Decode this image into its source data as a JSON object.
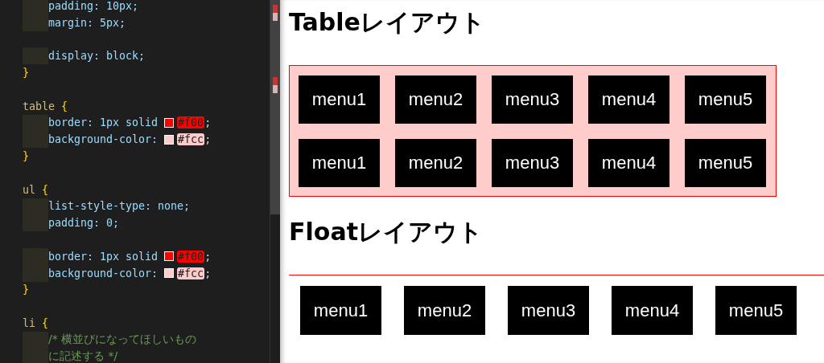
{
  "editor": {
    "lines": [
      {
        "kind": "decl",
        "text": "padding: 10px;"
      },
      {
        "kind": "decl",
        "text": "margin: 5px;"
      },
      {
        "kind": "blank"
      },
      {
        "kind": "decl",
        "text": "display: block;"
      },
      {
        "kind": "close",
        "text": "}"
      },
      {
        "kind": "blank"
      },
      {
        "kind": "open",
        "selector": "table",
        "brace": "{"
      },
      {
        "kind": "color",
        "text": "border: 1px solid",
        "color": "#ff0000",
        "code": "#f00",
        "end": ";"
      },
      {
        "kind": "color",
        "text": "background-color:",
        "color": "#ffcccc",
        "code": "#fcc",
        "end": ";"
      },
      {
        "kind": "close",
        "text": "}"
      },
      {
        "kind": "blank"
      },
      {
        "kind": "open",
        "selector": "ul",
        "brace": "{"
      },
      {
        "kind": "decl",
        "text": "list-style-type: none;"
      },
      {
        "kind": "decl",
        "text": "padding: 0;"
      },
      {
        "kind": "blank"
      },
      {
        "kind": "color",
        "text": "border: 1px solid",
        "color": "#ff0000",
        "code": "#f00",
        "end": ";"
      },
      {
        "kind": "color",
        "text": "background-color:",
        "color": "#ffcccc",
        "code": "#fcc",
        "end": ";"
      },
      {
        "kind": "close",
        "text": "}"
      },
      {
        "kind": "blank"
      },
      {
        "kind": "open",
        "selector": "li",
        "brace": "{"
      },
      {
        "kind": "comment",
        "text": "/* 横並びになってほしいもの"
      },
      {
        "kind": "comment",
        "text": "に記述する */"
      }
    ]
  },
  "preview": {
    "table_section": {
      "heading": "Tableレイアウト",
      "rows": [
        [
          "menu1",
          "menu2",
          "menu3",
          "menu4",
          "menu5"
        ],
        [
          "menu1",
          "menu2",
          "menu3",
          "menu4",
          "menu5"
        ]
      ]
    },
    "float_section": {
      "heading": "Floatレイアウト",
      "items": [
        "menu1",
        "menu2",
        "menu3",
        "menu4",
        "menu5"
      ]
    }
  }
}
